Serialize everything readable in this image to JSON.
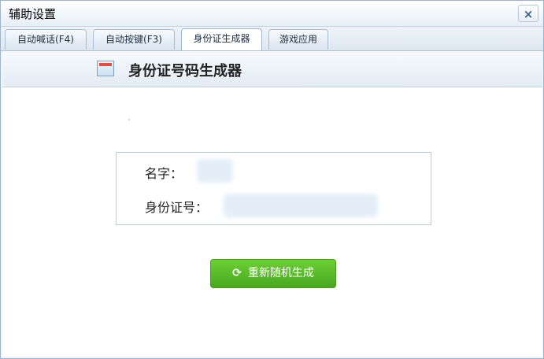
{
  "window": {
    "title": "辅助设置",
    "close_glyph": "×"
  },
  "tabs": [
    {
      "label": "自动喊话(F4)",
      "active": false
    },
    {
      "label": "自动按键(F3)",
      "active": false
    },
    {
      "label": "身份证生成器",
      "active": true
    },
    {
      "label": "游戏应用",
      "active": false
    }
  ],
  "panel": {
    "title": "身份证号码生成器",
    "icon": "window-icon"
  },
  "form": {
    "name_label": "名字：",
    "id_label": "身份证号：",
    "name_value": "",
    "id_value": ""
  },
  "actions": {
    "regenerate_label": "重新随机生成",
    "regenerate_icon": "refresh-icon"
  }
}
